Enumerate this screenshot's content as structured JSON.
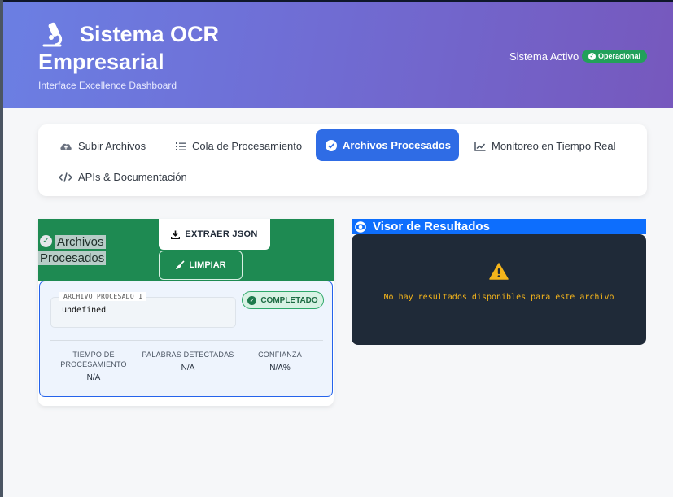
{
  "header": {
    "title_line1": "Sistema OCR",
    "title_line2": "Empresarial",
    "subtitle": "Interface Excellence Dashboard",
    "status_label": "Sistema Activo",
    "status_badge": "Operacional",
    "brand_icon": "microscope-icon"
  },
  "tabs": [
    {
      "label": "Subir Archivos",
      "icon": "cloud-upload-icon",
      "active": false
    },
    {
      "label": "Cola de Procesamiento",
      "icon": "list-icon",
      "active": false
    },
    {
      "label": "Archivos Procesados",
      "icon": "check-circle-icon",
      "active": true
    },
    {
      "label": "Monitoreo en Tiempo Real",
      "icon": "chart-line-icon",
      "active": false
    },
    {
      "label": "APIs & Documentación",
      "icon": "code-icon",
      "active": false
    }
  ],
  "processed": {
    "title_line1": "Archivos",
    "title_line2": "Procesados",
    "extract_button": "EXTRAER JSON",
    "clear_button": "LIMPIAR",
    "file_legend": "ARCHIVO PROCESADO 1",
    "file_value": "undefined",
    "status": "COMPLETADO",
    "metrics": [
      {
        "label_line1": "TIEMPO DE",
        "label_line2": "PROCESAMIENTO",
        "value": "N/A"
      },
      {
        "label_line1": "PALABRAS DETECTADAS",
        "label_line2": "",
        "value": "N/A"
      },
      {
        "label_line1": "CONFIANZA",
        "label_line2": "",
        "value": "N/A%"
      }
    ]
  },
  "viewer": {
    "title": "Visor de Resultados",
    "empty_message": "No hay resultados disponibles para este archivo"
  },
  "colors": {
    "header_gradient_start": "#6b7fe3",
    "header_gradient_end": "#7658bd",
    "active_tab": "#2f6ce5",
    "panel_green": "#1e8a52",
    "viewer_blue": "#0d6efd",
    "viewer_dark": "#1f2a38",
    "warning": "#f5b51b"
  }
}
